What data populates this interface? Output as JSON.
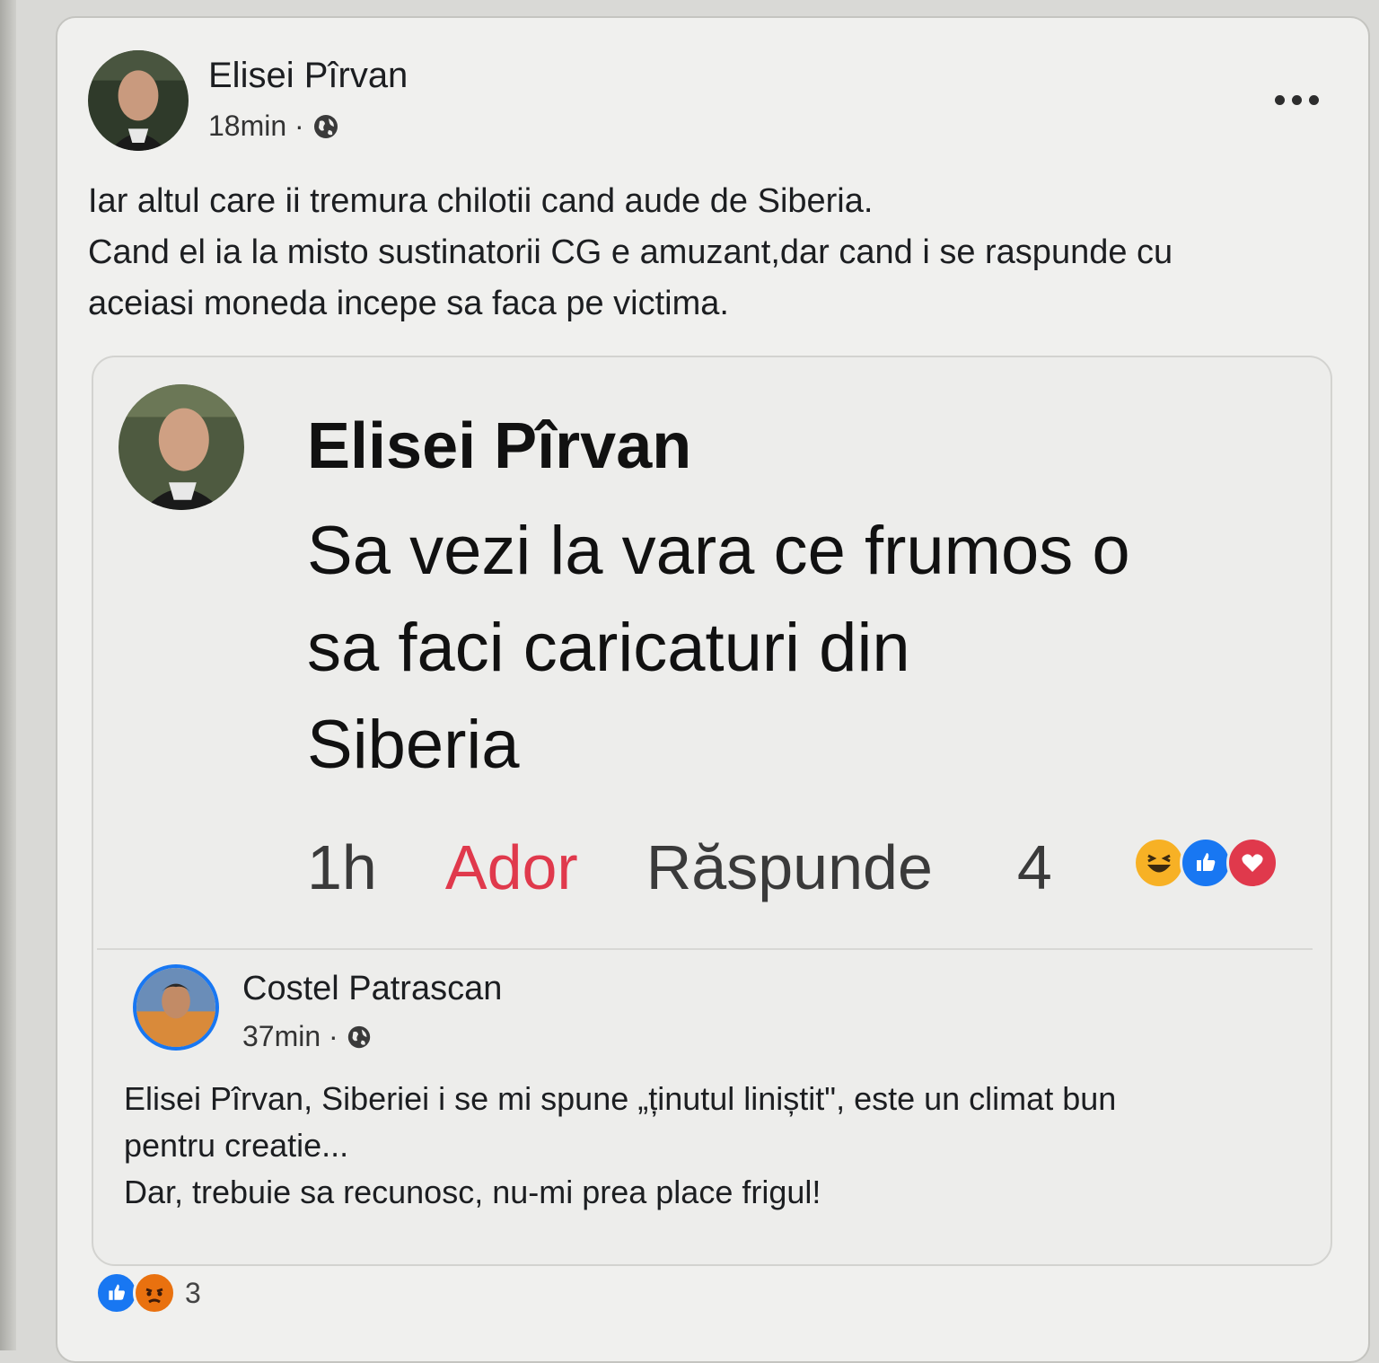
{
  "post": {
    "author": "Elisei Pîrvan",
    "time": "18min ·",
    "privacy_icon": "globe-icon",
    "more_icon": "more-options-icon",
    "text_lines": [
      "Iar altul care ii tremura chilotii cand aude de Siberia.",
      "Cand el ia la misto sustinatorii CG e amuzant,dar cand i se raspunde cu",
      "aceiasi moneda incepe sa faca pe victima."
    ]
  },
  "shared_post": {
    "comment": {
      "author": "Elisei Pîrvan",
      "text_lines": [
        "Sa vezi la vara ce frumos o",
        "sa faci caricaturi din",
        "Siberia"
      ],
      "time": "1h",
      "love_label": "Ador",
      "reply_label": "Răspunde",
      "reaction_count": "4",
      "reactions": [
        "haha-icon",
        "like-icon",
        "love-icon"
      ]
    },
    "author": "Costel Patrascan",
    "time": "37min ·",
    "privacy_icon": "globe-icon",
    "text_lines": [
      "Elisei Pîrvan, Siberiei i se mi spune „ținutul liniștit\", este un climat bun",
      "pentru creatie...",
      "Dar, trebuie sa recunosc, nu-mi prea place frigul!"
    ]
  },
  "footer": {
    "reactions": [
      "like-icon",
      "angry-icon"
    ],
    "count": "3"
  },
  "colors": {
    "love_red": "#e0394c",
    "like_blue": "#1877f2",
    "haha_yellow": "#f7b125",
    "angry_orange": "#e9710f"
  }
}
